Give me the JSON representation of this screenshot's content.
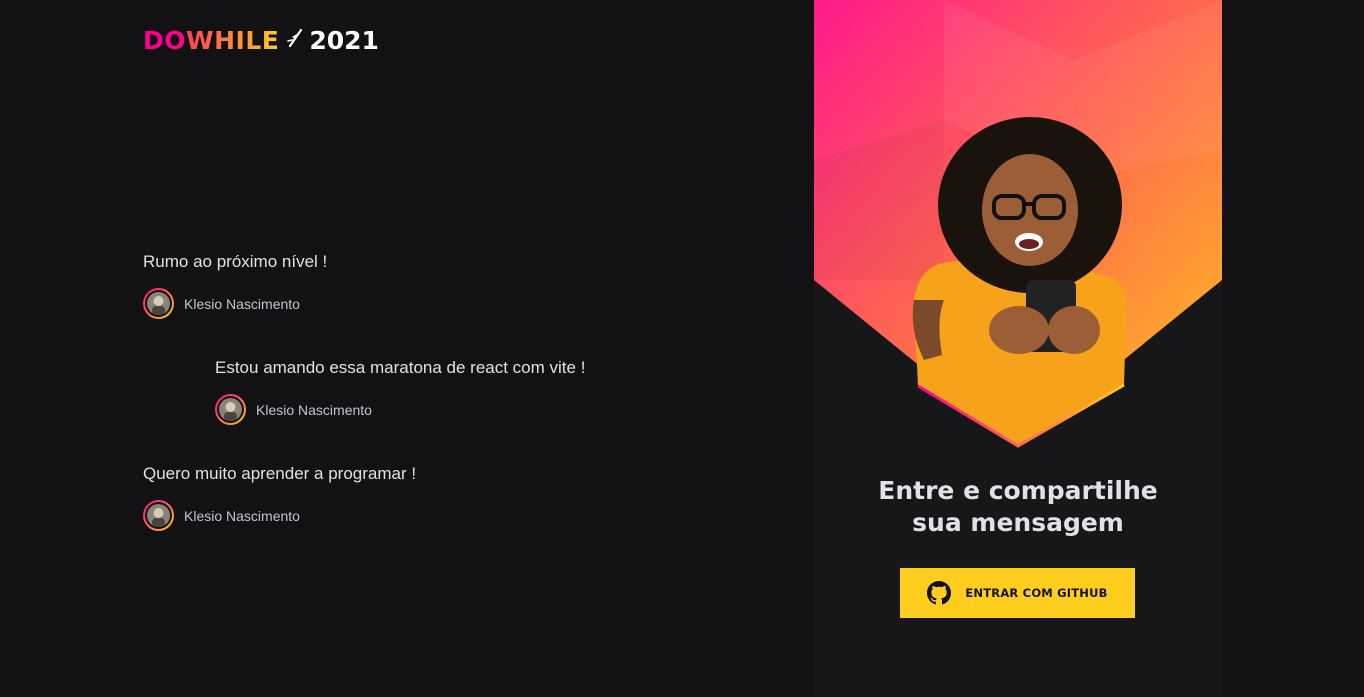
{
  "logo": {
    "part1": "DO",
    "part2": "WHILE",
    "year": "2021",
    "icon": "lightning-spark-icon"
  },
  "messages": [
    {
      "text": "Rumo ao próximo nível !",
      "user": "Klesio Nascimento"
    },
    {
      "text": "Estou amando essa maratona de react com vite !",
      "user": "Klesio Nascimento"
    },
    {
      "text": "Quero muito aprender a programar !",
      "user": "Klesio Nascimento"
    }
  ],
  "signin": {
    "title_line1": "Entre e compartilhe",
    "title_line2": "sua mensagem",
    "button_label": "ENTRAR COM GITHUB",
    "button_icon": "github-icon"
  },
  "colors": {
    "background": "#121214",
    "panel": "#17171a",
    "pink": "#ff008e",
    "yellow": "#ffcd1e",
    "text": "#e1e1e6"
  }
}
